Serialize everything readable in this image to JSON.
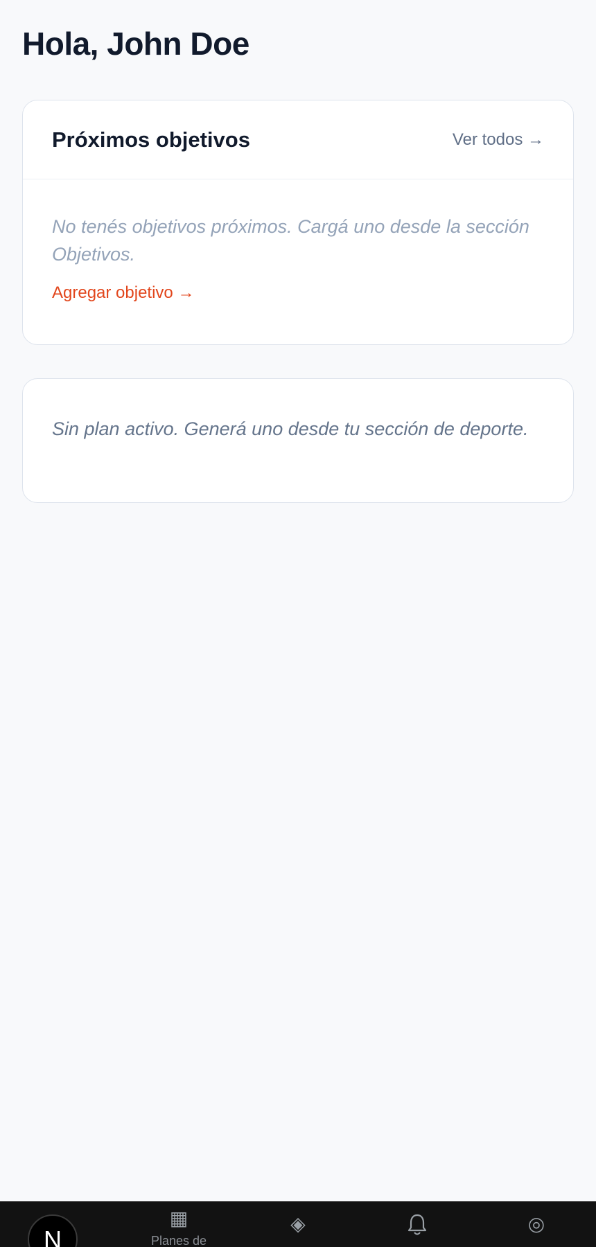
{
  "greeting": "Hola, John Doe",
  "goals_card": {
    "title": "Próximos objetivos",
    "see_all": "Ver todos →",
    "empty_text": "No tenés objetivos próximos. Cargá uno desde la sección Objetivos.",
    "add_link": "Agregar objetivo →"
  },
  "plan_card": {
    "empty_text": "Sin plan activo. Generá uno desde tu sección de deporte."
  },
  "bottom_nav": {
    "avatar_letter": "N",
    "items": [
      {
        "icon": "▦",
        "label": "Planes de"
      },
      {
        "icon": "◈",
        "label": ""
      },
      {
        "icon": "",
        "label": ""
      },
      {
        "icon": "◎",
        "label": ""
      }
    ]
  },
  "colors": {
    "background": "#f8f9fb",
    "accent": "#e2461c",
    "title": "#111a2c",
    "nav_bg": "#121212"
  }
}
